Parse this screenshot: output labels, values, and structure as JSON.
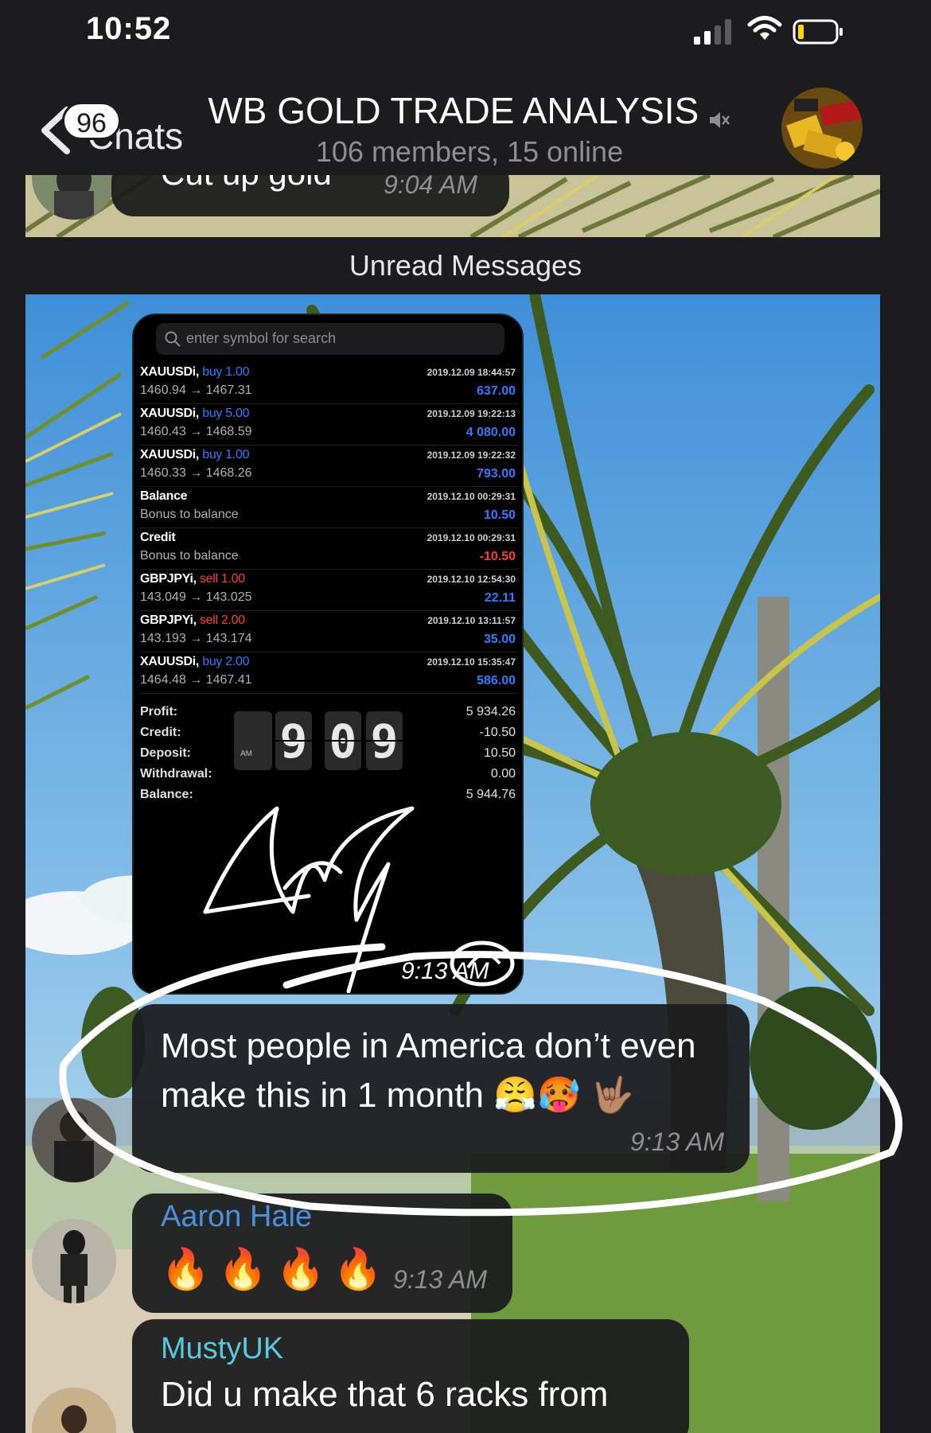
{
  "status_bar": {
    "time": "10:52"
  },
  "header": {
    "back_label": "Chats",
    "unread_count": "96",
    "title": "WB GOLD TRADE ANALYSIS",
    "subtitle": "106 members, 15 online"
  },
  "previous_message": {
    "text": "Cut up gold",
    "time": "9:04 AM"
  },
  "divider": "Unread Messages",
  "trade_screenshot": {
    "search_placeholder": "enter symbol for search",
    "deals": [
      {
        "symbol": "XAUUSDi,",
        "action": "buy 1.00",
        "action_color": "#2f7bff",
        "prices": "1460.94 → 1467.31",
        "time": "2019.12.09 18:44:57",
        "profit": "637.00",
        "profit_color": "#2f7bff"
      },
      {
        "symbol": "XAUUSDi,",
        "action": "buy 5.00",
        "action_color": "#2f7bff",
        "prices": "1460.43 → 1468.59",
        "time": "2019.12.09 19:22:13",
        "profit": "4 080.00",
        "profit_color": "#2f7bff"
      },
      {
        "symbol": "XAUUSDi,",
        "action": "buy 1.00",
        "action_color": "#2f7bff",
        "prices": "1460.33 → 1468.26",
        "time": "2019.12.09 19:22:32",
        "profit": "793.00",
        "profit_color": "#2f7bff"
      },
      {
        "symbol": "Balance",
        "action": "",
        "action_color": "#2f7bff",
        "prices": "Bonus to balance",
        "time": "2019.12.10 00:29:31",
        "profit": "10.50",
        "profit_color": "#2f7bff"
      },
      {
        "symbol": "Credit",
        "action": "",
        "action_color": "#2f7bff",
        "prices": "Bonus to balance",
        "time": "2019.12.10 00:29:31",
        "profit": "-10.50",
        "profit_color": "#ff3b30"
      },
      {
        "symbol": "GBPJPYi,",
        "action": "sell 1.00",
        "action_color": "#ff3b30",
        "prices": "143.049 → 143.025",
        "time": "2019.12.10 12:54:30",
        "profit": "22.11",
        "profit_color": "#2f7bff"
      },
      {
        "symbol": "GBPJPYi,",
        "action": "sell 2.00",
        "action_color": "#ff3b30",
        "prices": "143.193 → 143.174",
        "time": "2019.12.10 13:11:57",
        "profit": "35.00",
        "profit_color": "#2f7bff"
      },
      {
        "symbol": "XAUUSDi,",
        "action": "buy 2.00",
        "action_color": "#2f7bff",
        "prices": "1464.48 → 1467.41",
        "time": "2019.12.10 15:35:47",
        "profit": "586.00",
        "profit_color": "#2f7bff"
      }
    ],
    "summary": [
      {
        "label": "Profit:",
        "value": "5 934.26"
      },
      {
        "label": "Credit:",
        "value": "-10.50"
      },
      {
        "label": "Deposit:",
        "value": "10.50"
      },
      {
        "label": "Withdrawal:",
        "value": "0.00"
      },
      {
        "label": "Balance:",
        "value": "5 944.76"
      }
    ],
    "clock": {
      "ampm": "AM",
      "d1": "9",
      "d2": "0",
      "d3": "9"
    },
    "time": "9:13 AM"
  },
  "highlighted_message": {
    "text": "Most people in America don’t even make this in 1 month 😤🥵 🤟🏽",
    "time": "9:13 AM"
  },
  "fire_message": {
    "sender": "Aaron Hale",
    "sender_color": "#4a90e2",
    "emoji": "🔥🔥🔥🔥",
    "time": "9:13 AM"
  },
  "last_message": {
    "sender": "MustyUK",
    "text": "Did u make that 6 racks from"
  },
  "colors": {
    "header_bg": "#1c1c1e",
    "bubble_bg": "#1c1c1e",
    "buy": "#2f7bff",
    "sell": "#ff3b30",
    "secondary_text": "#8e8e93"
  }
}
